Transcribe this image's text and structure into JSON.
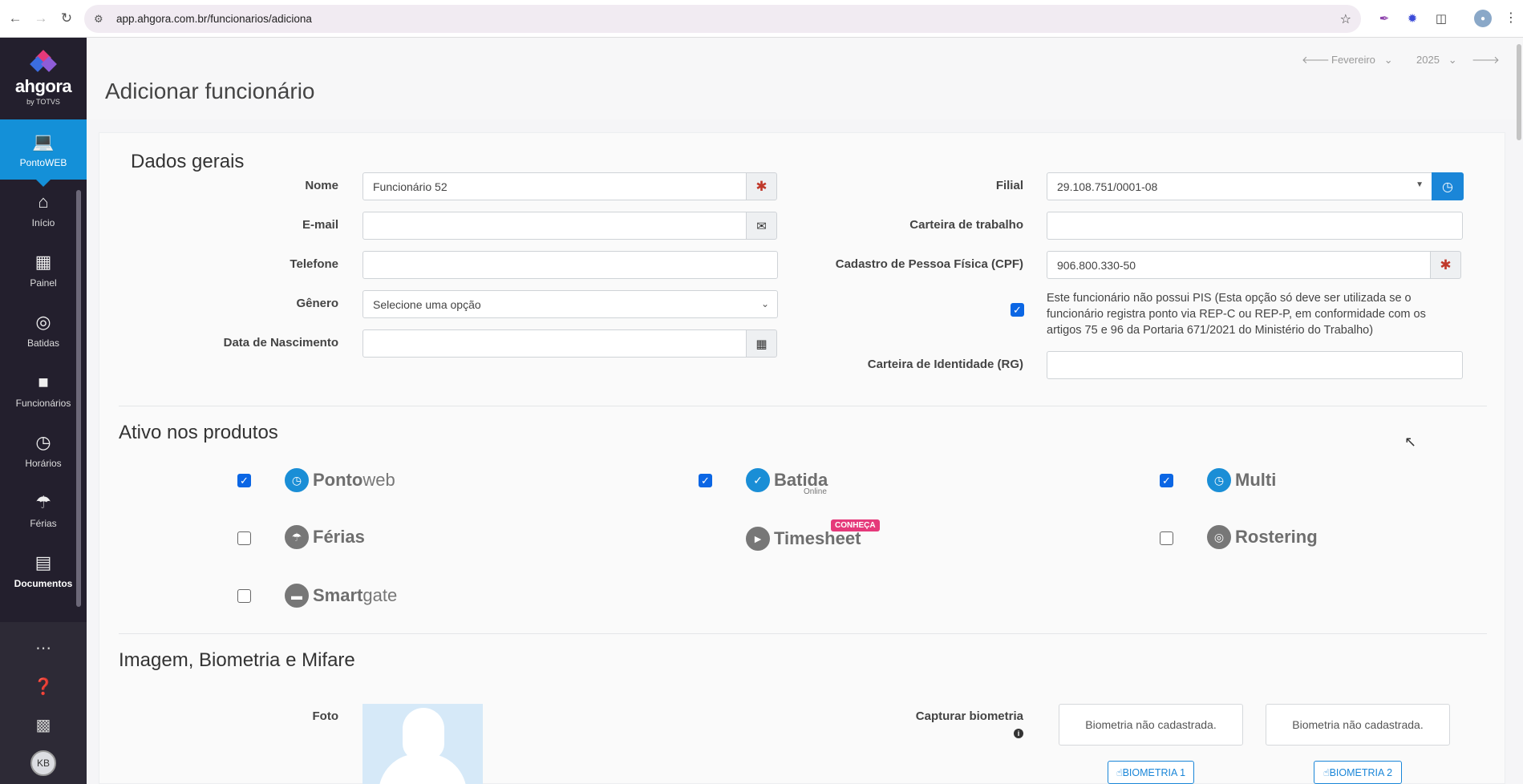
{
  "browser": {
    "url": "app.ahgora.com.br/funcionarios/adiciona"
  },
  "sidebar": {
    "brand": "ahgora",
    "brand_by": "by TOTVS",
    "items": [
      {
        "label": "PontoWEB",
        "icon": "monitor-icon"
      },
      {
        "label": "Início",
        "icon": "home-icon"
      },
      {
        "label": "Painel",
        "icon": "dashboard-icon"
      },
      {
        "label": "Batidas",
        "icon": "fingerprint-icon"
      },
      {
        "label": "Funcionários",
        "icon": "badge-icon"
      },
      {
        "label": "Horários",
        "icon": "clock-icon"
      },
      {
        "label": "Férias",
        "icon": "umbrella-icon"
      },
      {
        "label": "Documentos",
        "icon": "document-icon"
      }
    ],
    "avatar": "KB"
  },
  "header": {
    "title": "Adicionar funcionário",
    "month": "Fevereiro",
    "year": "2025"
  },
  "dados_gerais": {
    "title": "Dados gerais",
    "nome_label": "Nome",
    "nome_value": "Funcionário 52",
    "email_label": "E-mail",
    "email_value": "",
    "telefone_label": "Telefone",
    "telefone_value": "",
    "genero_label": "Gênero",
    "genero_value": "Selecione uma opção",
    "nascimento_label": "Data de Nascimento",
    "nascimento_value": "",
    "filial_label": "Filial",
    "filial_value": "29.108.751/0001-08",
    "carteira_label": "Carteira de trabalho",
    "carteira_value": "",
    "cpf_label": "Cadastro de Pessoa Física (CPF)",
    "cpf_value": "906.800.330-50",
    "pis_checked": true,
    "pis_note": "Este funcionário não possui PIS (Esta opção só deve ser utilizada se o funcionário registra ponto via REP-C ou REP-P, em conformidade com os artigos 75 e 96 da Portaria 671/2021 do Ministério do Trabalho)",
    "rg_label": "Carteira de Identidade (RG)",
    "rg_value": ""
  },
  "produtos": {
    "title": "Ativo nos produtos",
    "items": [
      {
        "name_bold": "Ponto",
        "name_light": "web",
        "checked": true
      },
      {
        "name_bold": "Batida",
        "name_light": "Online",
        "checked": true
      },
      {
        "name_bold": "Multi",
        "name_light": "",
        "checked": true
      },
      {
        "name_bold": "Férias",
        "name_light": "",
        "checked": false
      },
      {
        "name_bold": "Timesheet",
        "name_light": "",
        "badge": "CONHEÇA"
      },
      {
        "name_bold": "Rostering",
        "name_light": "",
        "checked": false
      },
      {
        "name_bold": "Smart",
        "name_light": "gate",
        "checked": false
      }
    ]
  },
  "imagem": {
    "title": "Imagem, Biometria e Mifare",
    "foto_label": "Foto",
    "biometria_label": "Capturar biometria",
    "bio1_status": "Biometria não cadastrada.",
    "bio2_status": "Biometria não cadastrada.",
    "bio1_button": "BIOMETRIA 1",
    "bio2_button": "BIOMETRIA 2"
  }
}
